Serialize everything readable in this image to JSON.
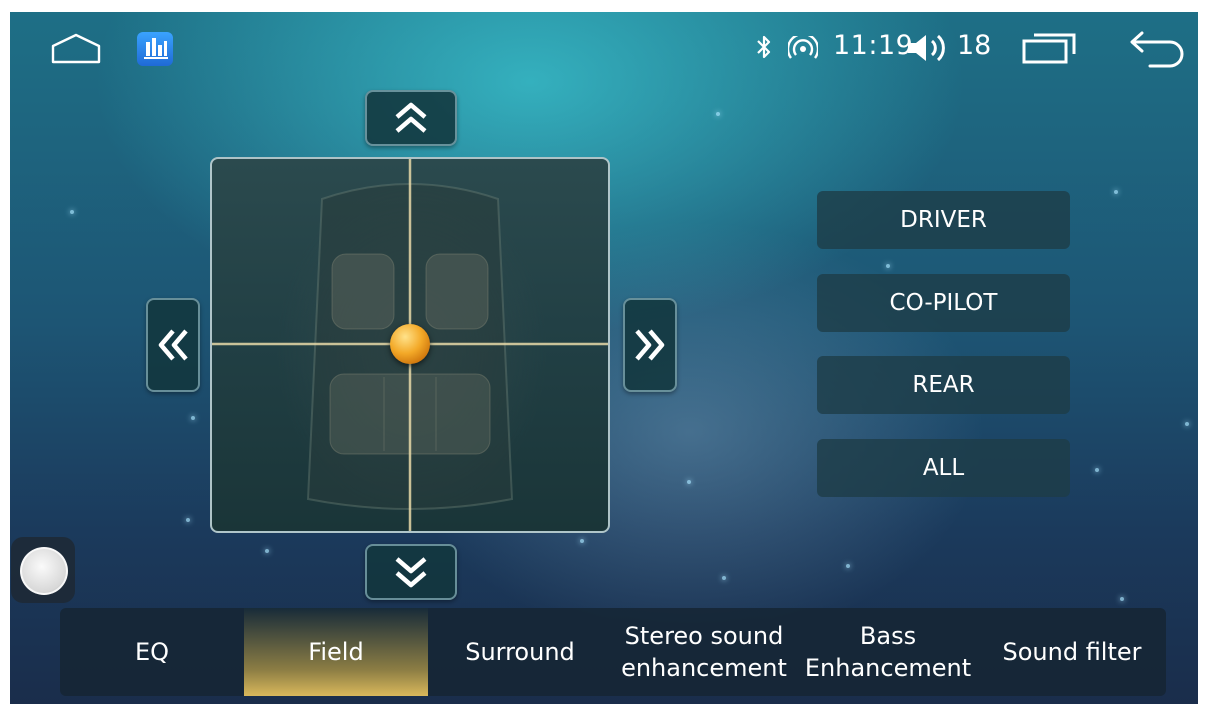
{
  "status_bar": {
    "home_icon": "home-icon",
    "app_icon": "equalizer-app-icon",
    "bluetooth_icon": "bluetooth-icon",
    "hotspot_icon": "hotspot-icon",
    "time": "11:19",
    "volume_icon": "volume-icon",
    "volume": "18",
    "recent_apps_icon": "recent-apps-icon",
    "back_icon": "back-icon"
  },
  "field": {
    "up_icon": "double-chevron-up-icon",
    "down_icon": "double-chevron-down-icon",
    "left_icon": "double-chevron-left-icon",
    "right_icon": "double-chevron-right-icon",
    "focus_handle": "balance-focus-handle",
    "focus_x": 0.5,
    "focus_y": 0.5
  },
  "zones": [
    {
      "label": "DRIVER"
    },
    {
      "label": "CO-PILOT"
    },
    {
      "label": "REAR"
    },
    {
      "label": "ALL"
    }
  ],
  "tabs": [
    {
      "label": "EQ",
      "active": false
    },
    {
      "label": "Field",
      "active": true
    },
    {
      "label": "Surround",
      "active": false
    },
    {
      "label": "Stereo sound enhancement",
      "active": false
    },
    {
      "label": "Bass Enhancement",
      "active": false
    },
    {
      "label": "Sound filter",
      "active": false
    }
  ],
  "colors": {
    "active_tab": "#d9b85b",
    "handle": "#f3a928",
    "crosshair": "#e7d9a8"
  }
}
